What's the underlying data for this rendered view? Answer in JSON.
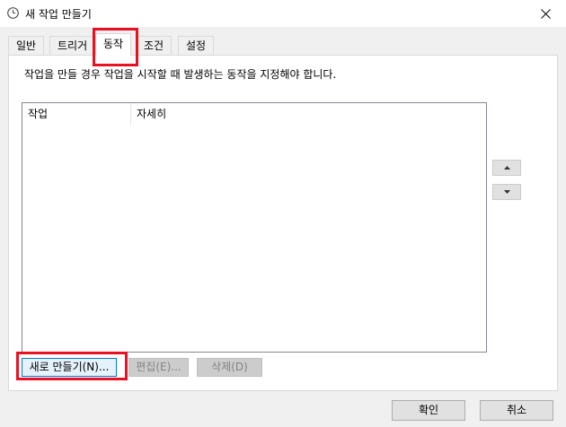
{
  "window": {
    "title": "새 작업 만들기",
    "icon": "clock-icon"
  },
  "tabs": [
    {
      "label": "일반",
      "active": false
    },
    {
      "label": "트리거",
      "active": false
    },
    {
      "label": "동작",
      "active": true
    },
    {
      "label": "조건",
      "active": false
    },
    {
      "label": "설정",
      "active": false
    }
  ],
  "panel": {
    "instruction": "작업을 만들 경우 작업을 시작할 때 발생하는 동작을 지정해야 합니다.",
    "columns": [
      "작업",
      "자세히"
    ],
    "rows": []
  },
  "buttons": {
    "new": "새로 만들기(N)...",
    "edit": "편집(E)...",
    "delete": "삭제(D)"
  },
  "footer": {
    "ok": "확인",
    "cancel": "취소"
  },
  "colors": {
    "highlight": "#e81123",
    "accent": "#0078d7",
    "disabled_text": "#838383"
  }
}
